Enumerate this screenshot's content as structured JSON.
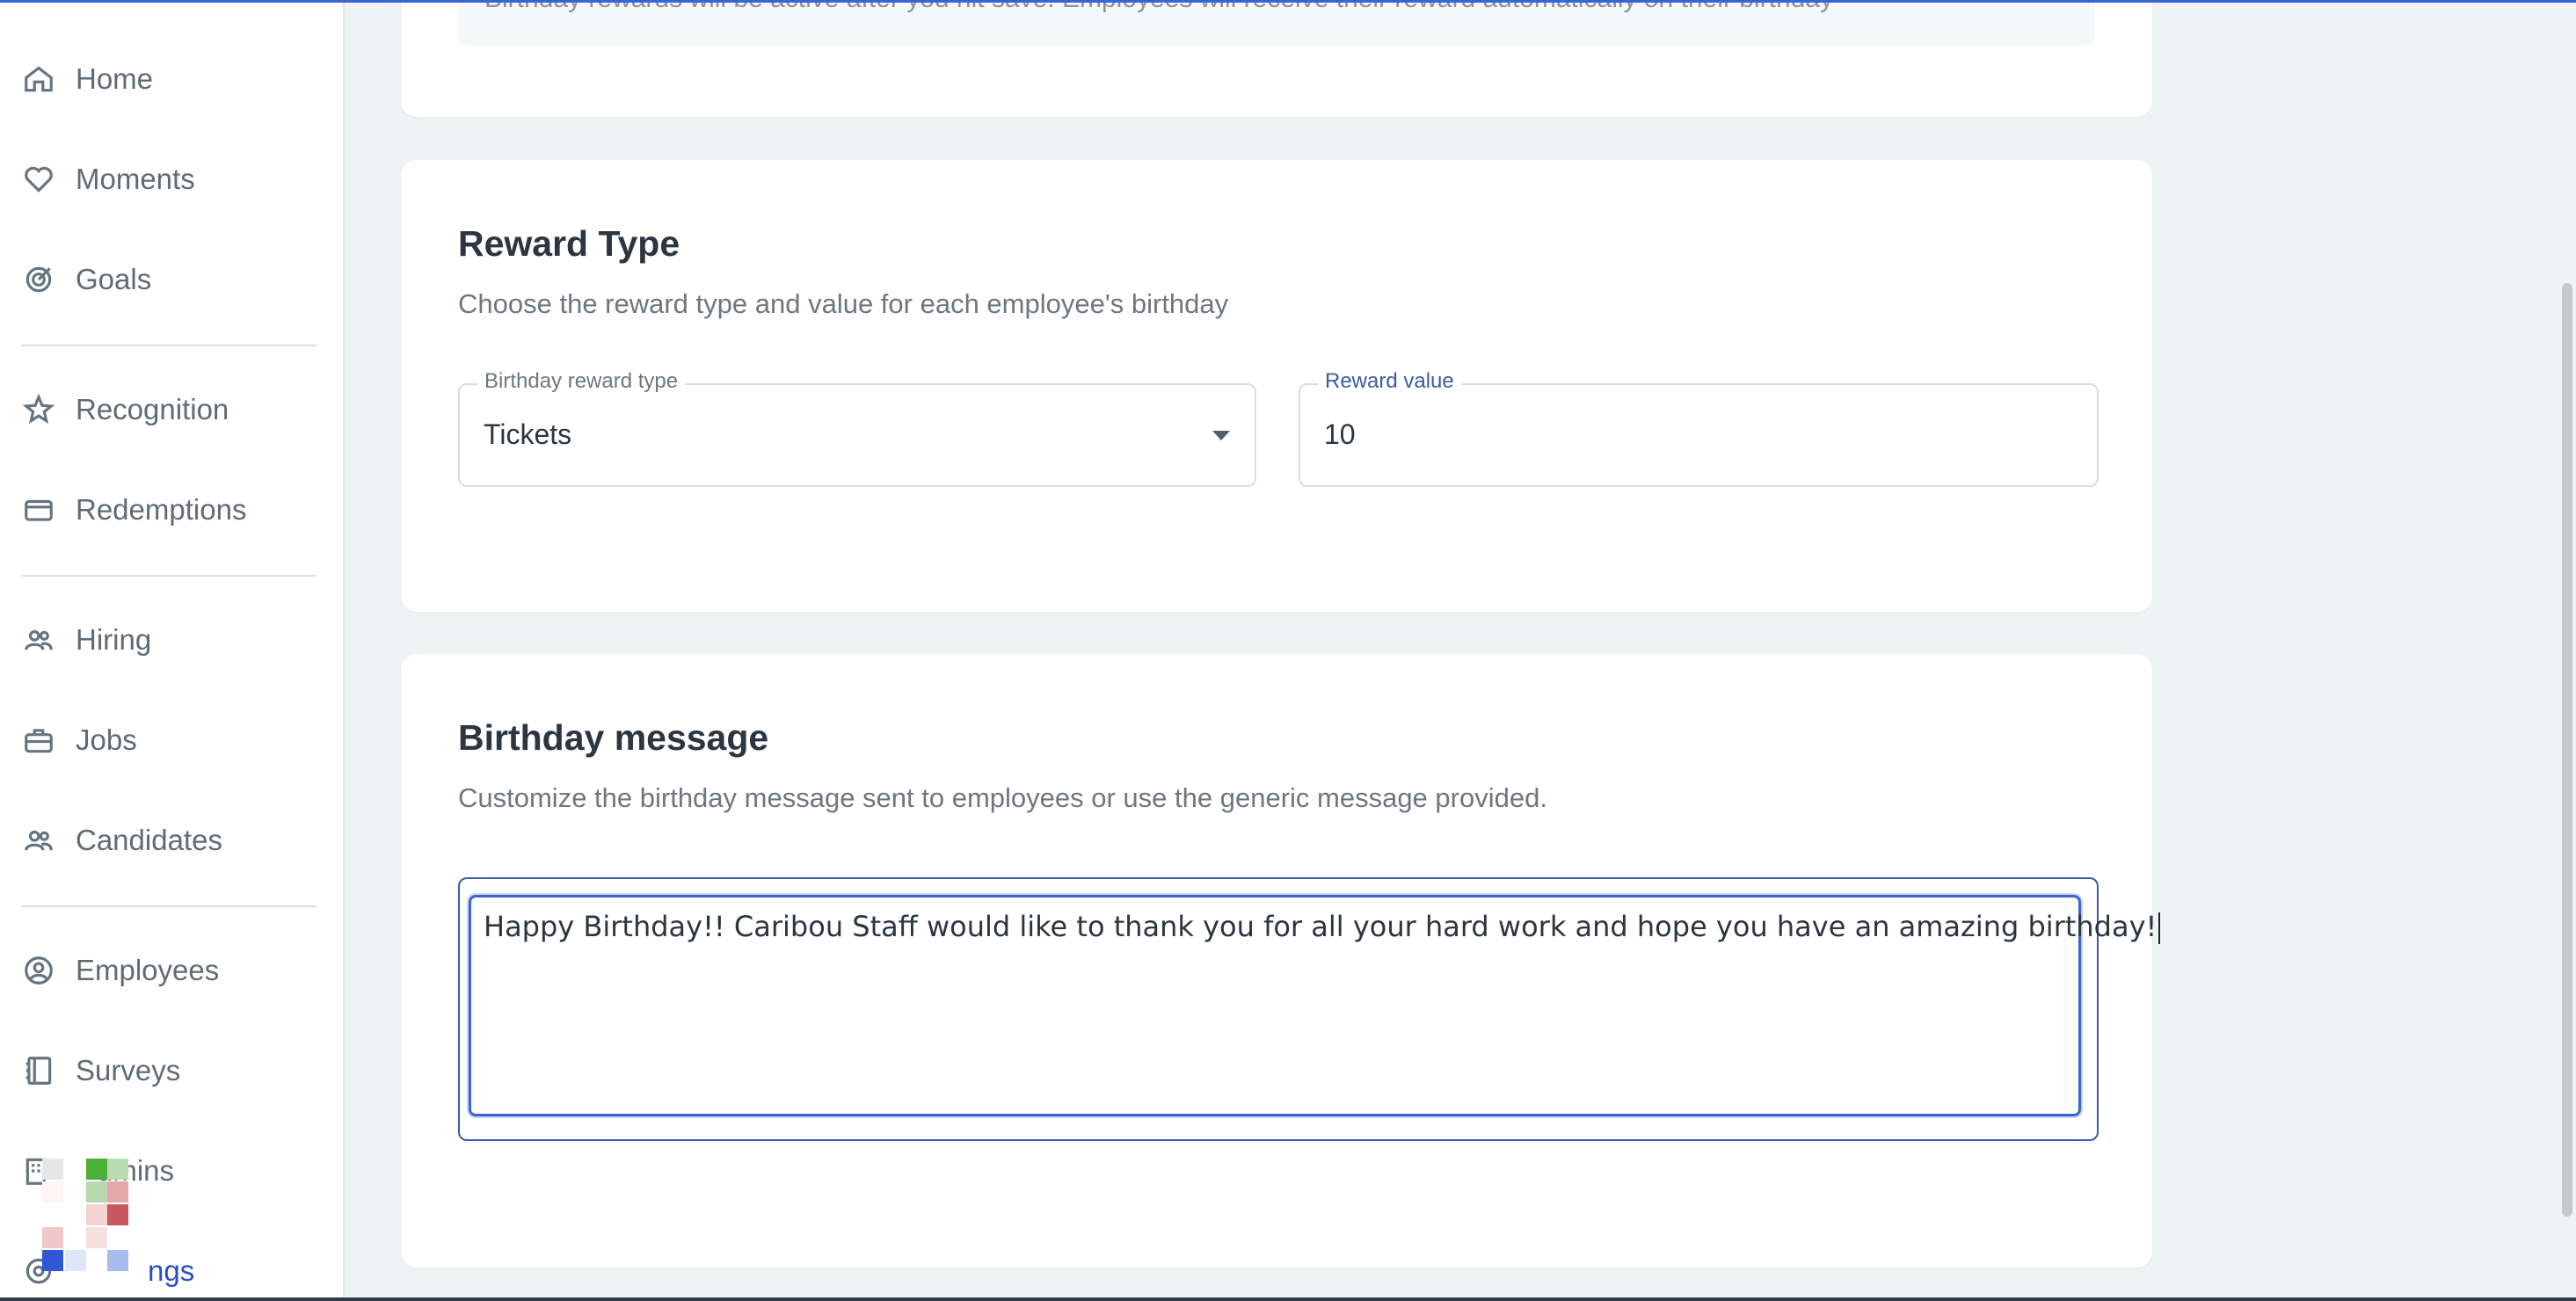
{
  "sidebar": {
    "items": [
      {
        "label": "Home",
        "icon": "home-icon"
      },
      {
        "label": "Moments",
        "icon": "heart-icon"
      },
      {
        "label": "Goals",
        "icon": "target-icon"
      },
      {
        "label": "Recognition",
        "icon": "star-badge-icon"
      },
      {
        "label": "Redemptions",
        "icon": "credit-card-icon"
      },
      {
        "label": "Hiring",
        "icon": "people-icon"
      },
      {
        "label": "Jobs",
        "icon": "briefcase-icon"
      },
      {
        "label": "Candidates",
        "icon": "people-icon"
      },
      {
        "label": "Employees",
        "icon": "user-circle-icon"
      },
      {
        "label": "Surveys",
        "icon": "notebook-icon"
      },
      {
        "label": "Admins",
        "icon": "building-icon"
      },
      {
        "label": "Settings",
        "icon": "gear-icon"
      }
    ],
    "visible_partial": {
      "admins": "dmins",
      "settings": "ngs"
    }
  },
  "banner": {
    "text": "Birthday rewards will be active after you hit save. Employees will receive their reward automatically on their birthday"
  },
  "reward_type": {
    "title": "Reward Type",
    "subtitle": "Choose the reward type and value for each employee's birthday",
    "type_field": {
      "label": "Birthday reward type",
      "value": "Tickets"
    },
    "value_field": {
      "label": "Reward value",
      "value": "10"
    }
  },
  "birthday_message": {
    "title": "Birthday message",
    "subtitle": "Customize the birthday message sent to employees or use the generic message provided.",
    "message": "Happy Birthday!! Caribou Staff would like to thank you for all your hard work and hope you have an amazing birthday!"
  },
  "colors": {
    "accent": "#3b63d8",
    "focus_label": "#3b5ca8",
    "page_bg": "#eef3f4"
  }
}
